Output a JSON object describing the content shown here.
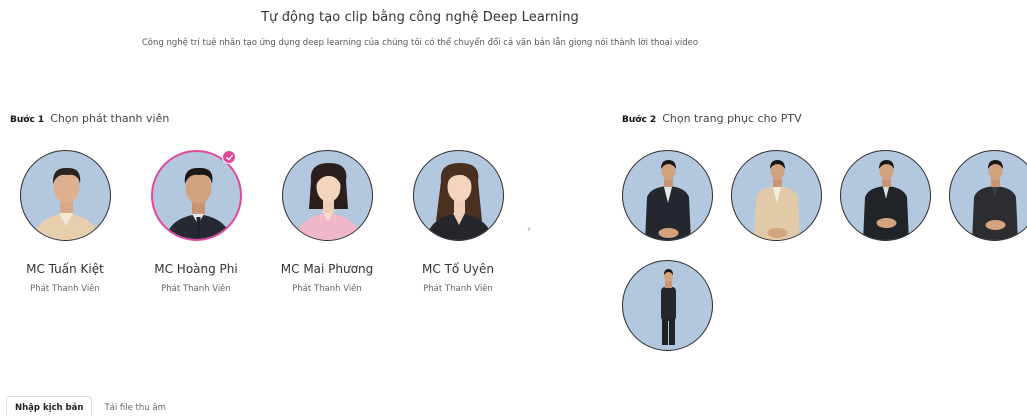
{
  "header": {
    "title": "Tự động tạo clip bằng công nghệ Deep Learning",
    "subtitle": "Công nghệ trí tuệ nhân tạo ứng dụng deep learning của chúng tôi có thể chuyển đổi cả văn bản lẫn giọng nói thành lời thoại video"
  },
  "step1": {
    "num": "Bước 1",
    "label": "Chọn phát thanh viên"
  },
  "step2": {
    "num": "Bước 2",
    "label": "Chọn trang phục cho PTV"
  },
  "presenters": [
    {
      "name": "MC Tuấn Kiệt",
      "role": "Phát Thanh Viên",
      "selected": false
    },
    {
      "name": "MC Hoàng Phi",
      "role": "Phát Thanh Viên",
      "selected": true
    },
    {
      "name": "MC Mai Phương",
      "role": "Phát Thanh Viên",
      "selected": false
    },
    {
      "name": "MC Tố Uyên",
      "role": "Phát Thanh Viên",
      "selected": false
    }
  ],
  "next_arrow": "›",
  "tabs": [
    {
      "label": "Nhập kịch bản",
      "active": true
    },
    {
      "label": "Tải file thu âm",
      "active": false
    }
  ],
  "colors": {
    "accent": "#e0499a",
    "avatar_bg": "#b3c8df"
  }
}
